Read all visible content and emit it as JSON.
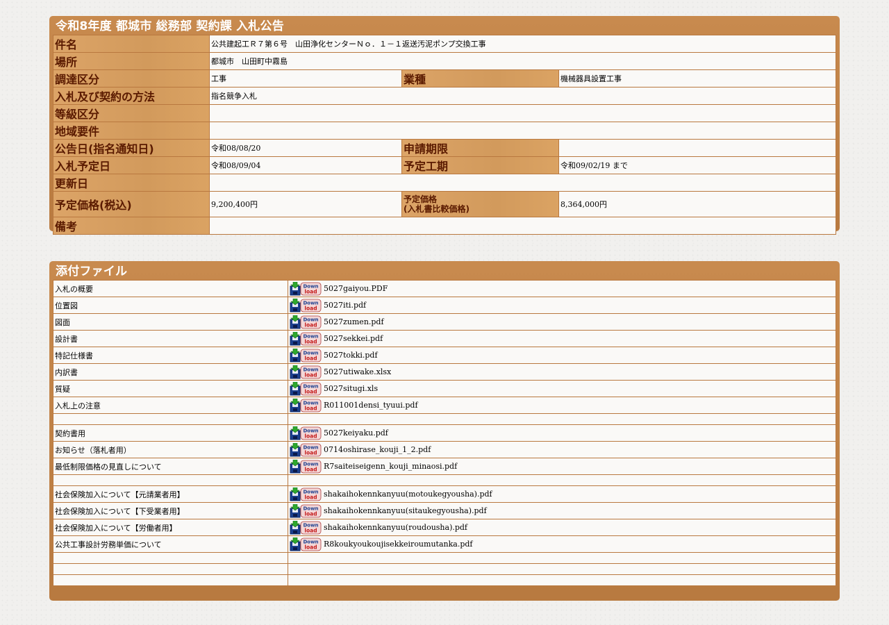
{
  "notice": {
    "title": "令和8年度 都城市 総務部 契約課 入札公告",
    "rows": {
      "name_label": "件名",
      "name_value": "公共建起工Ｒ７第６号　山田浄化センターＮｏ．１－１返送汚泥ポンプ交換工事",
      "place_label": "場所",
      "place_value": "都城市　山田町中霧島",
      "category_label": "調達区分",
      "category_value": "工事",
      "type_label": "業種",
      "type_value": "機械器具設置工事",
      "method_label": "入札及び契約の方法",
      "method_value": "指名競争入札",
      "grade_label": "等級区分",
      "grade_value": "",
      "region_label": "地域要件",
      "region_value": "",
      "announce_label": "公告日(指名通知日)",
      "announce_value": "令和08/08/20",
      "deadline_label": "申請期限",
      "deadline_value": "",
      "bid_date_label": "入札予定日",
      "bid_date_value": "令和08/09/04",
      "period_label": "予定工期",
      "period_value": "令和09/02/19 まで",
      "update_label": "更新日",
      "update_value": "",
      "price_label": "予定価格(税込)",
      "price_value": "9,200,400円",
      "compare_label_1": "予定価格",
      "compare_label_2": "(入札書比較価格)",
      "compare_value": "8,364,000円",
      "remarks_label": "備考",
      "remarks_value": ""
    }
  },
  "attachments": {
    "title": "添付ファイル",
    "icon": "download-icon",
    "files": [
      {
        "label": "入札の概要",
        "file": "5027gaiyou.PDF"
      },
      {
        "label": "位置図",
        "file": "5027iti.pdf"
      },
      {
        "label": "図面",
        "file": "5027zumen.pdf"
      },
      {
        "label": "設計書",
        "file": "5027sekkei.pdf"
      },
      {
        "label": "特記仕様書",
        "file": "5027tokki.pdf"
      },
      {
        "label": "内訳書",
        "file": "5027utiwake.xlsx"
      },
      {
        "label": "質疑",
        "file": "5027situgi.xls"
      },
      {
        "label": "入札上の注意",
        "file": "R011001densi_tyuui.pdf"
      },
      {
        "label": "",
        "file": ""
      },
      {
        "label": "契約書用",
        "file": "5027keiyaku.pdf"
      },
      {
        "label": "お知らせ（落札者用）",
        "file": "0714oshirase_kouji_1_2.pdf"
      },
      {
        "label": "最低制限価格の見直しについて",
        "file": "R7saiteiseigenn_kouji_minaosi.pdf"
      },
      {
        "label": "",
        "file": ""
      },
      {
        "label": "社会保険加入について【元請業者用】",
        "file": "shakaihokennkanyuu(motoukegyousha).pdf"
      },
      {
        "label": "社会保険加入について【下受業者用】",
        "file": "shakaihokennkanyuu(sitaukegyousha).pdf"
      },
      {
        "label": "社会保険加入について【労働者用】",
        "file": "shakaihokennkanyuu(roudousha).pdf"
      },
      {
        "label": "公共工事設計労務単価について",
        "file": "R8koukyoukoujisekkeiroumutanka.pdf"
      },
      {
        "label": "",
        "file": ""
      },
      {
        "label": "",
        "file": ""
      },
      {
        "label": "",
        "file": ""
      }
    ]
  }
}
